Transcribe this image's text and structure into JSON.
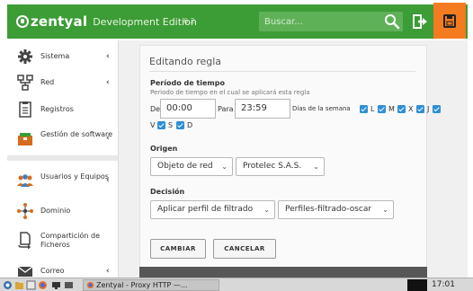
{
  "header": {
    "logo_text": "zentyal",
    "edition": "Development Edition",
    "version": "6.2",
    "search_placeholder": "Buscar...",
    "colors": {
      "header_bg": "#3c9c35",
      "save_bg": "#f47b20"
    }
  },
  "sidebar": {
    "items": [
      {
        "label": "Sistema",
        "icon": "gear-icon",
        "chevron": "‹"
      },
      {
        "label": "Red",
        "icon": "network-icon",
        "chevron": "‹"
      },
      {
        "label": "Registros",
        "icon": "logs-icon",
        "chevron": ""
      },
      {
        "label": "Gestión de software",
        "icon": "software-package-icon",
        "chevron": "‹"
      },
      {
        "label": "Usuarios y Equipos",
        "icon": "users-icon",
        "chevron": "‹"
      },
      {
        "label": "Dominio",
        "icon": "domain-icon",
        "chevron": ""
      },
      {
        "label": "Compartición de Ficheros",
        "icon": "file-share-icon",
        "chevron": ""
      },
      {
        "label": "Correo",
        "icon": "mail-icon",
        "chevron": "‹"
      }
    ]
  },
  "form": {
    "title": "Editando regla",
    "period": {
      "title": "Período de tiempo",
      "subtitle": "Periodo de tiempo en el cual se aplicará esta regla",
      "from_label": "De",
      "from_value": "00:00",
      "to_label": "Para",
      "to_value": "23:59",
      "days_label": "Días de la semana",
      "days": [
        {
          "label": "L",
          "checked": true
        },
        {
          "label": "M",
          "checked": true
        },
        {
          "label": "X",
          "checked": true
        },
        {
          "label": "J",
          "checked": true
        },
        {
          "label": "V",
          "checked": true
        },
        {
          "label": "S",
          "checked": true
        },
        {
          "label": "D",
          "checked": true
        }
      ]
    },
    "origin": {
      "title": "Origen",
      "type_value": "Objeto de red",
      "object_value": "Protelec S.A.S."
    },
    "decision": {
      "title": "Decisión",
      "action_value": "Aplicar perfil de filtrado",
      "profile_value": "Perfiles-filtrado-oscar"
    },
    "buttons": {
      "change": "CAMBIAR",
      "cancel": "CANCELAR"
    }
  },
  "taskbar": {
    "task_title": "Zentyal - Proxy HTTP —...",
    "clock": "17:01"
  }
}
